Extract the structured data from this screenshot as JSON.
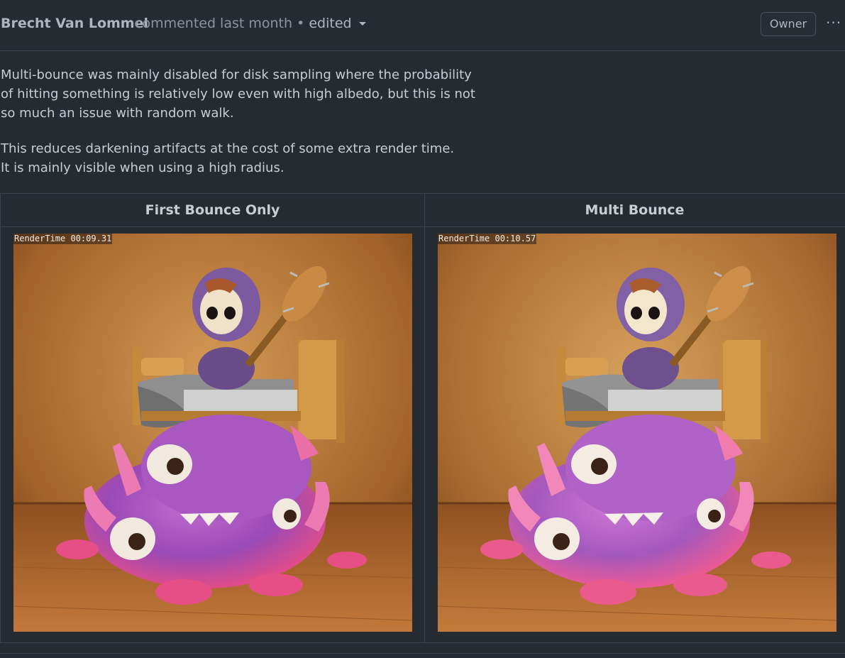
{
  "comment": {
    "author": "Brecht Van Lommel",
    "action": "commented last month",
    "separator": "•",
    "edited_label": "edited",
    "role_badge": "Owner",
    "menu_icon": "more-horizontal-icon",
    "paragraphs": [
      "Multi-bounce was mainly disabled for disk sampling where the probability\nof hitting something is relatively low even with high albedo, but this is not\nso much an issue with random walk.",
      "This reduces darkening artifacts at the cost of some extra render time.\nIt is mainly visible when using a high radius."
    ]
  },
  "comparison": {
    "columns": [
      {
        "header": "First Bounce Only",
        "render_time": "RenderTime 00:09.31",
        "image": "monster-under-bed-render"
      },
      {
        "header": "Multi Bounce",
        "render_time": "RenderTime 00:10.57",
        "image": "monster-under-bed-render"
      }
    ]
  },
  "colors": {
    "background": "#262a31",
    "border": "#3b414a",
    "text": "#c8cdd3",
    "muted_text": "#8d949d"
  }
}
